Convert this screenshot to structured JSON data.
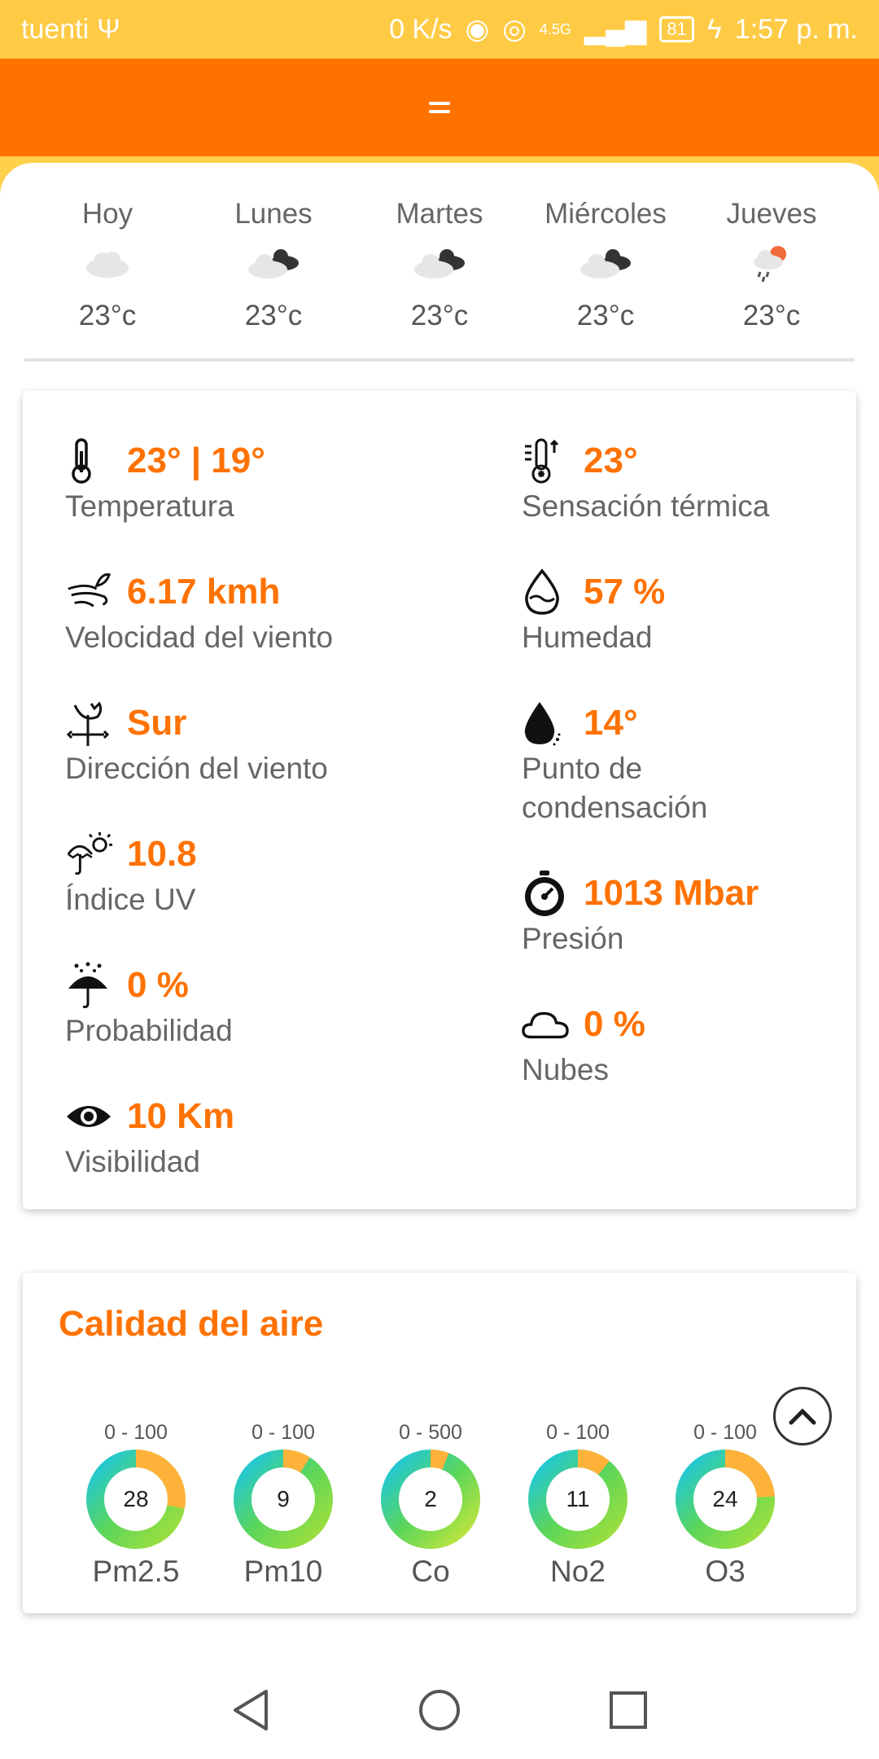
{
  "status": {
    "carrier": "tuenti",
    "speed": "0 K/s",
    "network": "4.5G",
    "battery": "81",
    "time": "1:57 p. m."
  },
  "forecast": [
    {
      "day": "Hoy",
      "temp": "23°c",
      "icon": "cloud-icon"
    },
    {
      "day": "Lunes",
      "temp": "23°c",
      "icon": "cloudy-icon"
    },
    {
      "day": "Martes",
      "temp": "23°c",
      "icon": "cloudy-icon"
    },
    {
      "day": "Miércoles",
      "temp": "23°c",
      "icon": "cloudy-icon"
    },
    {
      "day": "Jueves",
      "temp": "23°c",
      "icon": "sun-rain-icon"
    }
  ],
  "details": {
    "temperature": {
      "value": "23° | 19°",
      "label": "Temperatura"
    },
    "feels_like": {
      "value": "23°",
      "label": "Sensación térmica"
    },
    "wind_speed": {
      "value": "6.17 kmh",
      "label": "Velocidad del viento"
    },
    "humidity": {
      "value": "57 %",
      "label": "Humedad"
    },
    "wind_direction": {
      "value": "Sur",
      "label": "Dirección del viento"
    },
    "dew_point": {
      "value": "14°",
      "label_line1": "Punto de",
      "label_line2": "condensación"
    },
    "uv": {
      "value": "10.8",
      "label": "Índice UV"
    },
    "pressure": {
      "value": "1013 Mbar",
      "label": "Presión"
    },
    "probability": {
      "value": "0 %",
      "label": "Probabilidad"
    },
    "clouds": {
      "value": "0 %",
      "label": "Nubes"
    },
    "visibility": {
      "value": "10 Km",
      "label": "Visibilidad"
    }
  },
  "air_quality": {
    "title": "Calidad del aire",
    "items": [
      {
        "range": "0 - 100",
        "value": "28",
        "name": "Pm2.5",
        "level": 0.28
      },
      {
        "range": "0 - 100",
        "value": "9",
        "name": "Pm10",
        "level": 0.09
      },
      {
        "range": "0 - 500",
        "value": "2",
        "name": "Co",
        "level": 0.004
      },
      {
        "range": "0 - 100",
        "value": "11",
        "name": "No2",
        "level": 0.11
      },
      {
        "range": "0 - 100",
        "value": "24",
        "name": "O3",
        "level": 0.24
      }
    ]
  },
  "colors": {
    "accent": "#FF7200",
    "statusbar": "#FFCB45"
  }
}
